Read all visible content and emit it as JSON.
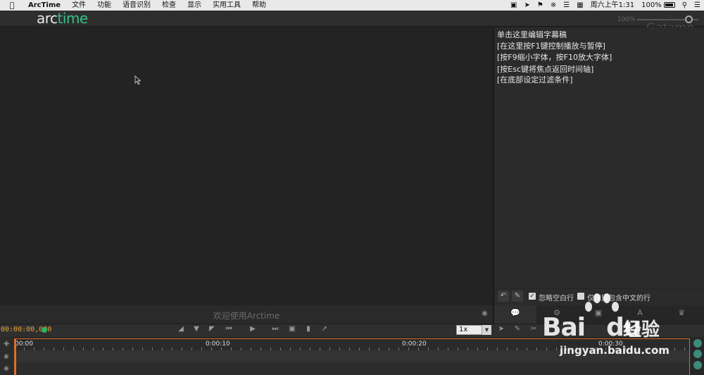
{
  "menubar": {
    "apple_icon": "apple-icon",
    "items": [
      "ArcTime",
      "文件",
      "功能",
      "语音识别",
      "检查",
      "显示",
      "实用工具",
      "帮助"
    ],
    "status": {
      "datetime": "周六上午1:31",
      "battery": "100%"
    }
  },
  "toolbar": {
    "logo_part1": "arc",
    "logo_part2": "time",
    "zoom_label": "100%",
    "watermark": "Gatamo",
    "logo_color": "#36c08a"
  },
  "video": {
    "welcome": "欢迎使用Arctime"
  },
  "editor": {
    "lines": [
      "单击这里编辑字幕稿",
      "[在这里按F1键控制播放与暂停]",
      "[按F9缩小字体，按F10放大字体]",
      "[按Esc键将焦点返回时间轴]",
      "[在底部设定过滤条件]"
    ],
    "opt_ignore_empty": "忽略空白行",
    "opt_chinese_only": "仅保留包含中文的行"
  },
  "timeline": {
    "timecode": "00:00:00,000",
    "timecode_color": "#e8a33a",
    "speed": "1x",
    "ruler_labels": [
      "00:00",
      "0:00:10",
      "0:00:20",
      "0:00:30"
    ],
    "accent": "#d46a25"
  },
  "watermark": {
    "brand": "Bai",
    "brand2": "du",
    "cn": "经验",
    "url": "jingyan.baidu.com"
  }
}
